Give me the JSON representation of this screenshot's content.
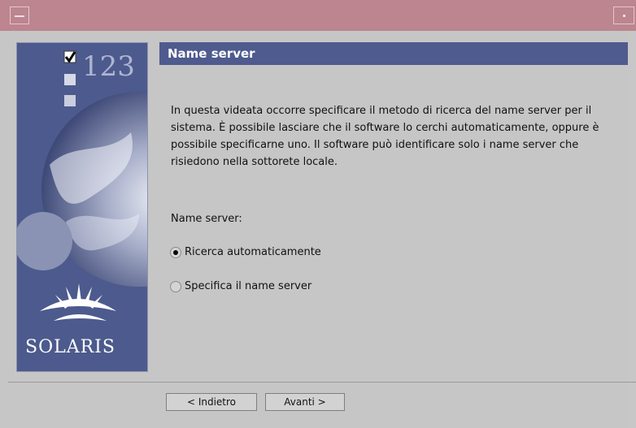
{
  "window": {
    "system_menu_icon": "window-menu-icon",
    "minimize_icon": "minimize-icon"
  },
  "logo": {
    "steps_text": "123",
    "brand": "SOLARIS"
  },
  "header": {
    "title": "Name server"
  },
  "description": "In questa videata occorre specificare il metodo di ricerca del name server per il sistema. È possibile lasciare che il software lo cerchi automaticamente, oppure è possibile specificarne uno. Il software può identificare solo i name server che risiedono nella sottorete locale.",
  "field_label": "Name server:",
  "options": [
    {
      "label": "Ricerca automaticamente",
      "selected": true
    },
    {
      "label": "Specifica il name server",
      "selected": false
    }
  ],
  "buttons": {
    "back": "< Indietro",
    "next": "Avanti >"
  },
  "colors": {
    "titlebar": "#bc8590",
    "header": "#4f5b8e",
    "panel": "#4d5a8d",
    "background": "#c6c6c6"
  }
}
